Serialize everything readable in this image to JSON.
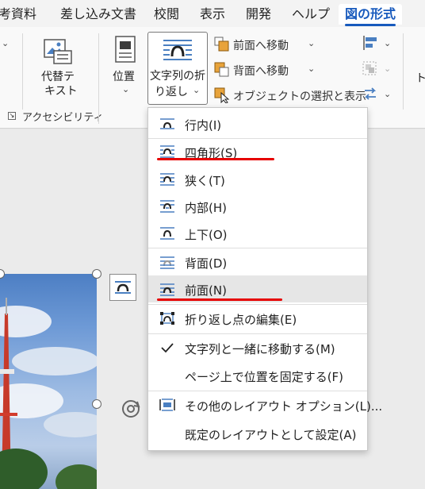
{
  "tabs": [
    {
      "label": "考資料"
    },
    {
      "label": "差し込み文書"
    },
    {
      "label": "校閲"
    },
    {
      "label": "表示"
    },
    {
      "label": "開発"
    },
    {
      "label": "ヘルプ"
    },
    {
      "label": "図の形式",
      "active": true
    }
  ],
  "ribbon": {
    "alt_text_line1": "代替テ",
    "alt_text_line2": "キスト",
    "position_label": "位置",
    "wrap_line1": "文字列の折",
    "wrap_line2": "り返し",
    "bring_forward": "前面へ移動",
    "send_backward": "背面へ移動",
    "selection_pane": "オブジェクトの選択と表示",
    "group_accessibility": "アクセシビリティ",
    "cut_letter": "ト"
  },
  "menu": {
    "items": [
      {
        "label": "行内(I)",
        "icon": "inline-wrap-icon"
      },
      {
        "label": "四角形(S)",
        "icon": "square-wrap-icon"
      },
      {
        "label": "狭く(T)",
        "icon": "tight-wrap-icon"
      },
      {
        "label": "内部(H)",
        "icon": "through-wrap-icon"
      },
      {
        "label": "上下(O)",
        "icon": "top-bottom-wrap-icon"
      },
      {
        "label": "背面(D)",
        "icon": "behind-text-icon"
      },
      {
        "label": "前面(N)",
        "icon": "in-front-text-icon",
        "hover": true
      },
      {
        "label": "折り返し点の編集(E)",
        "icon": "edit-wrap-points-icon"
      },
      {
        "label": "文字列と一緒に移動する(M)",
        "icon": "checkmark-icon",
        "checked": true
      },
      {
        "label": "ページ上で位置を固定する(F)",
        "icon": ""
      },
      {
        "label": "その他のレイアウト オプション(L)...",
        "icon": "layout-options-icon"
      },
      {
        "label": "既定のレイアウトとして設定(A)",
        "icon": ""
      }
    ]
  },
  "colors": {
    "accent": "#185abd",
    "annotation": "#e60000",
    "hover": "#e6e6e6"
  }
}
